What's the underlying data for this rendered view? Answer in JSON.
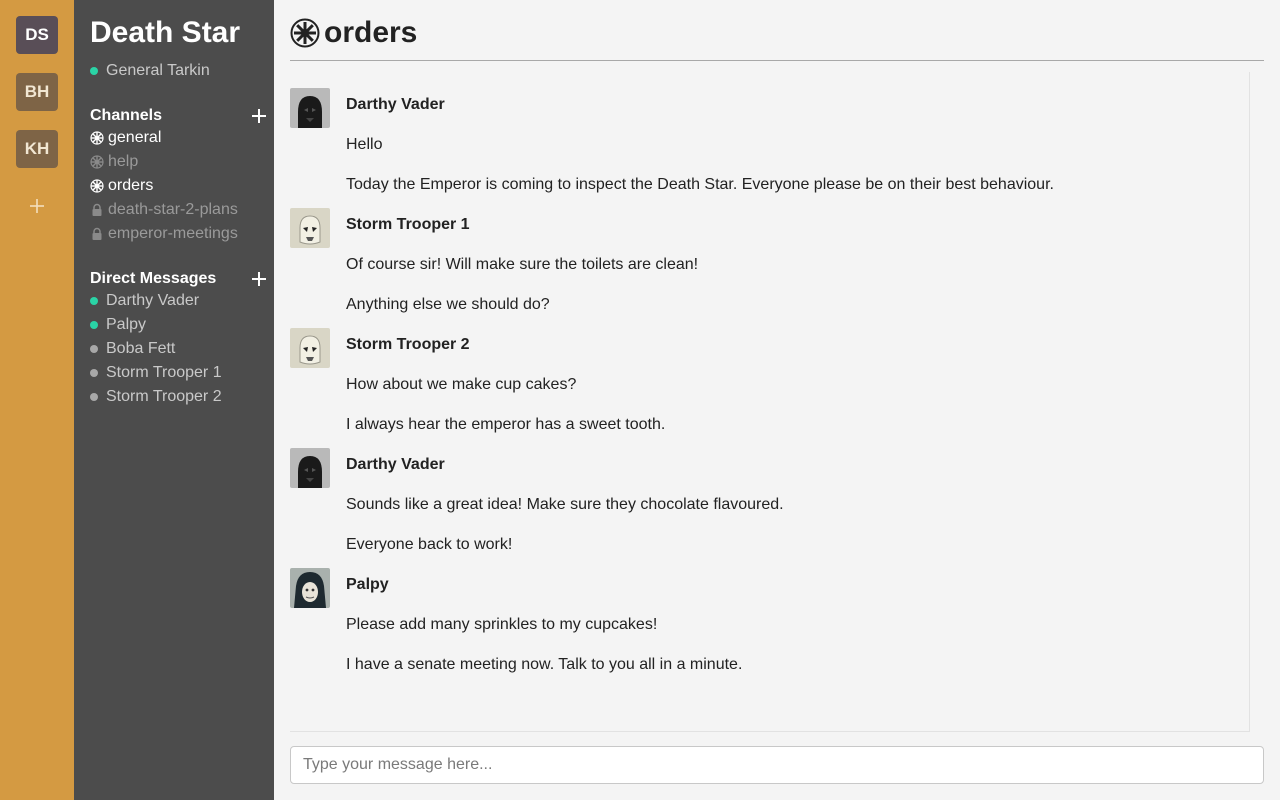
{
  "teams": [
    {
      "initials": "DS",
      "active": true
    },
    {
      "initials": "BH",
      "active": false
    },
    {
      "initials": "KH",
      "active": false
    }
  ],
  "sidebar": {
    "team_name": "Death Star",
    "current_user": "General Tarkin",
    "channels_heading": "Channels",
    "channels": [
      {
        "name": "general",
        "icon": "empire-icon",
        "state": "unread"
      },
      {
        "name": "help",
        "icon": "empire-icon",
        "state": "muted"
      },
      {
        "name": "orders",
        "icon": "empire-icon",
        "state": "active"
      },
      {
        "name": "death-star-2-plans",
        "icon": "lock-icon",
        "state": "muted"
      },
      {
        "name": "emperor-meetings",
        "icon": "lock-icon",
        "state": "muted"
      }
    ],
    "dm_heading": "Direct Messages",
    "direct_messages": [
      {
        "name": "Darthy Vader",
        "online": true
      },
      {
        "name": "Palpy",
        "online": true
      },
      {
        "name": "Boba Fett",
        "online": false
      },
      {
        "name": "Storm Trooper 1",
        "online": false
      },
      {
        "name": "Storm Trooper 2",
        "online": false
      }
    ]
  },
  "channel": {
    "title": "orders",
    "icon": "empire-icon"
  },
  "messages": [
    {
      "author": "Darthy Vader",
      "avatar": "vader",
      "lines": [
        "Hello",
        "Today the Emperor is coming to inspect the Death Star. Everyone please be on their best behaviour."
      ]
    },
    {
      "author": "Storm Trooper 1",
      "avatar": "trooper",
      "lines": [
        "Of course sir! Will make sure the toilets are clean!",
        "Anything else we should do?"
      ]
    },
    {
      "author": "Storm Trooper 2",
      "avatar": "trooper",
      "lines": [
        "How about we make cup cakes?",
        "I always hear the emperor has a sweet tooth."
      ]
    },
    {
      "author": "Darthy Vader",
      "avatar": "vader",
      "lines": [
        "Sounds like a great idea! Make sure they chocolate flavoured.",
        "Everyone back to work!"
      ]
    },
    {
      "author": "Palpy",
      "avatar": "palpatine",
      "lines": [
        "Please add many sprinkles to my cupcakes!",
        "I have a senate meeting now. Talk to you all in a minute."
      ]
    }
  ],
  "composer": {
    "placeholder": "Type your message here...",
    "value": ""
  },
  "colors": {
    "rail": "#d49a42",
    "sidebar": "#4c4c4c",
    "online": "#2ad4a6",
    "offline": "#a8a8a8"
  }
}
